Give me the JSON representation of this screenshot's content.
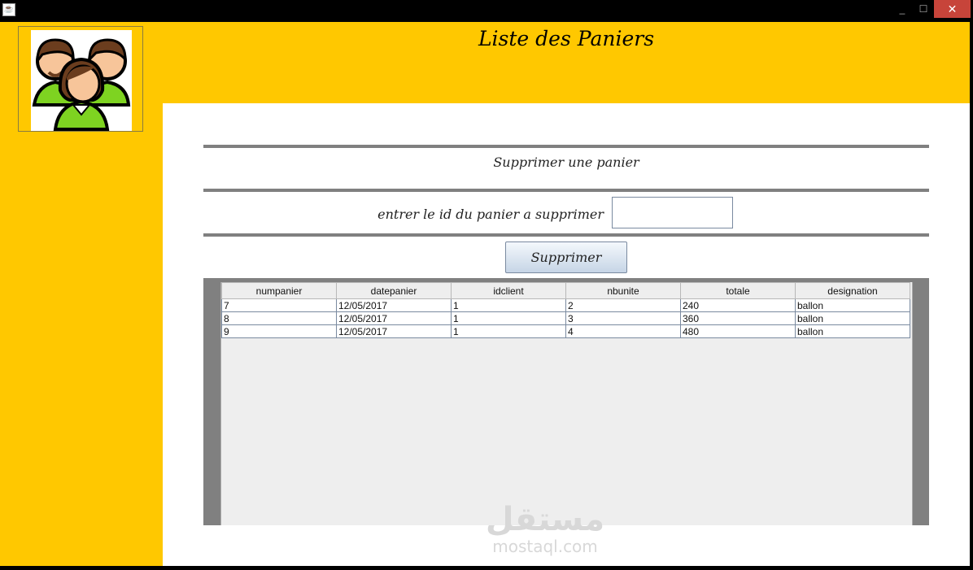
{
  "window": {
    "app_icon": "java-icon",
    "minimize": "_",
    "maximize": "☐",
    "close": "✕"
  },
  "header": {
    "title": "Liste  des Paniers",
    "logo_icon": "users-group-icon"
  },
  "delete_section": {
    "heading": "Supprimer une panier",
    "id_label": "entrer le id du panier a supprimer",
    "id_value": "",
    "button_label": "Supprimer"
  },
  "table": {
    "columns": [
      "numpanier",
      "datepanier",
      "idclient",
      "nbunite",
      "totale",
      "designation"
    ],
    "rows": [
      [
        "7",
        "12/05/2017",
        "1",
        "2",
        "240",
        "ballon"
      ],
      [
        "8",
        "12/05/2017",
        "1",
        "3",
        "360",
        "ballon"
      ],
      [
        "9",
        "12/05/2017",
        "1",
        "4",
        "480",
        "ballon"
      ]
    ]
  },
  "watermark": {
    "arabic": "مستقل",
    "latin": "mostaql.com"
  },
  "colors": {
    "frame": "#ffc800",
    "panel": "#808080",
    "content": "#ffffff"
  }
}
